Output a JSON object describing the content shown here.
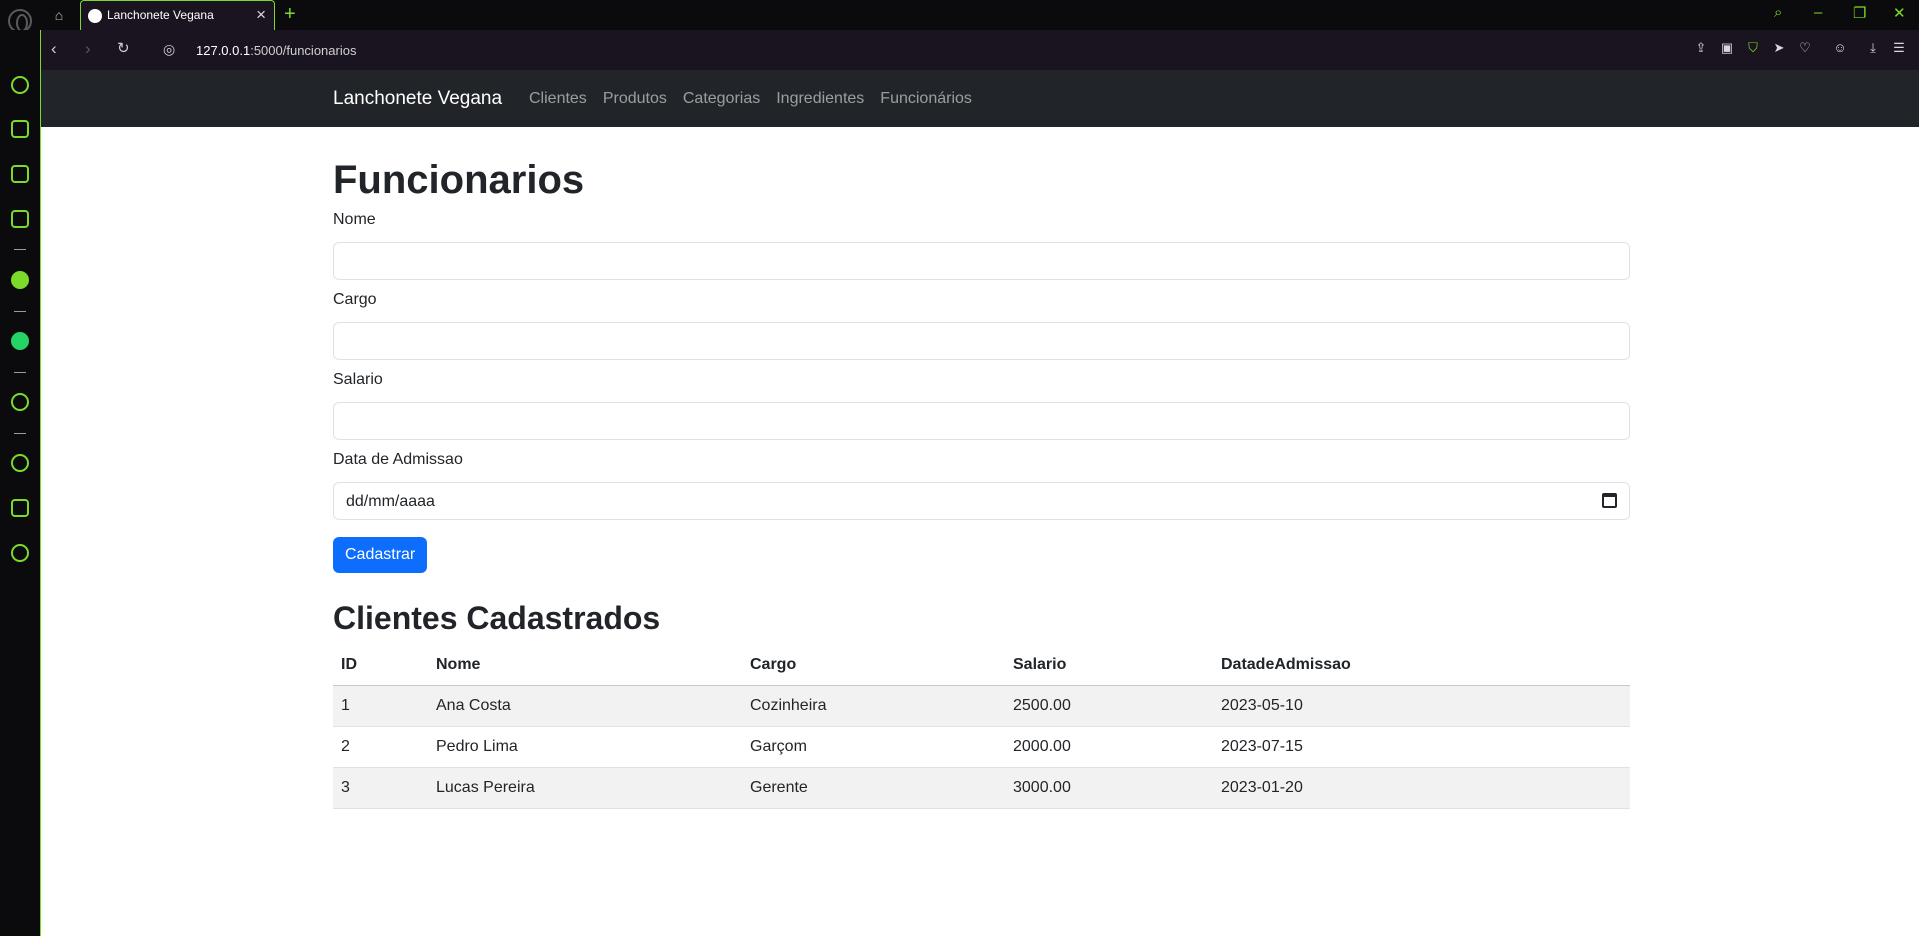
{
  "browser": {
    "tab_title": "Lanchonete Vegana",
    "url_host": "127.0.0.1",
    "url_rest": ":5000/funcionarios",
    "accent_color": "#7cdb2a"
  },
  "navbar": {
    "brand": "Lanchonete Vegana",
    "links": [
      "Clientes",
      "Produtos",
      "Categorias",
      "Ingredientes",
      "Funcionários"
    ]
  },
  "form": {
    "title": "Funcionarios",
    "fields": [
      {
        "label": "Nome",
        "value": ""
      },
      {
        "label": "Cargo",
        "value": ""
      },
      {
        "label": "Salario",
        "value": ""
      },
      {
        "label": "Data de Admissao",
        "value": "dd/mm/aaaa"
      }
    ],
    "submit_label": "Cadastrar"
  },
  "list": {
    "title": "Clientes Cadastrados",
    "columns": [
      "ID",
      "Nome",
      "Cargo",
      "Salario",
      "DatadeAdmissao"
    ],
    "rows": [
      [
        "1",
        "Ana Costa",
        "Cozinheira",
        "2500.00",
        "2023-05-10"
      ],
      [
        "2",
        "Pedro Lima",
        "Garçom",
        "2000.00",
        "2023-07-15"
      ],
      [
        "3",
        "Lucas Pereira",
        "Gerente",
        "3000.00",
        "2023-01-20"
      ]
    ]
  },
  "colors": {
    "navbar_bg": "#212529",
    "primary_button": "#0d6efd"
  }
}
